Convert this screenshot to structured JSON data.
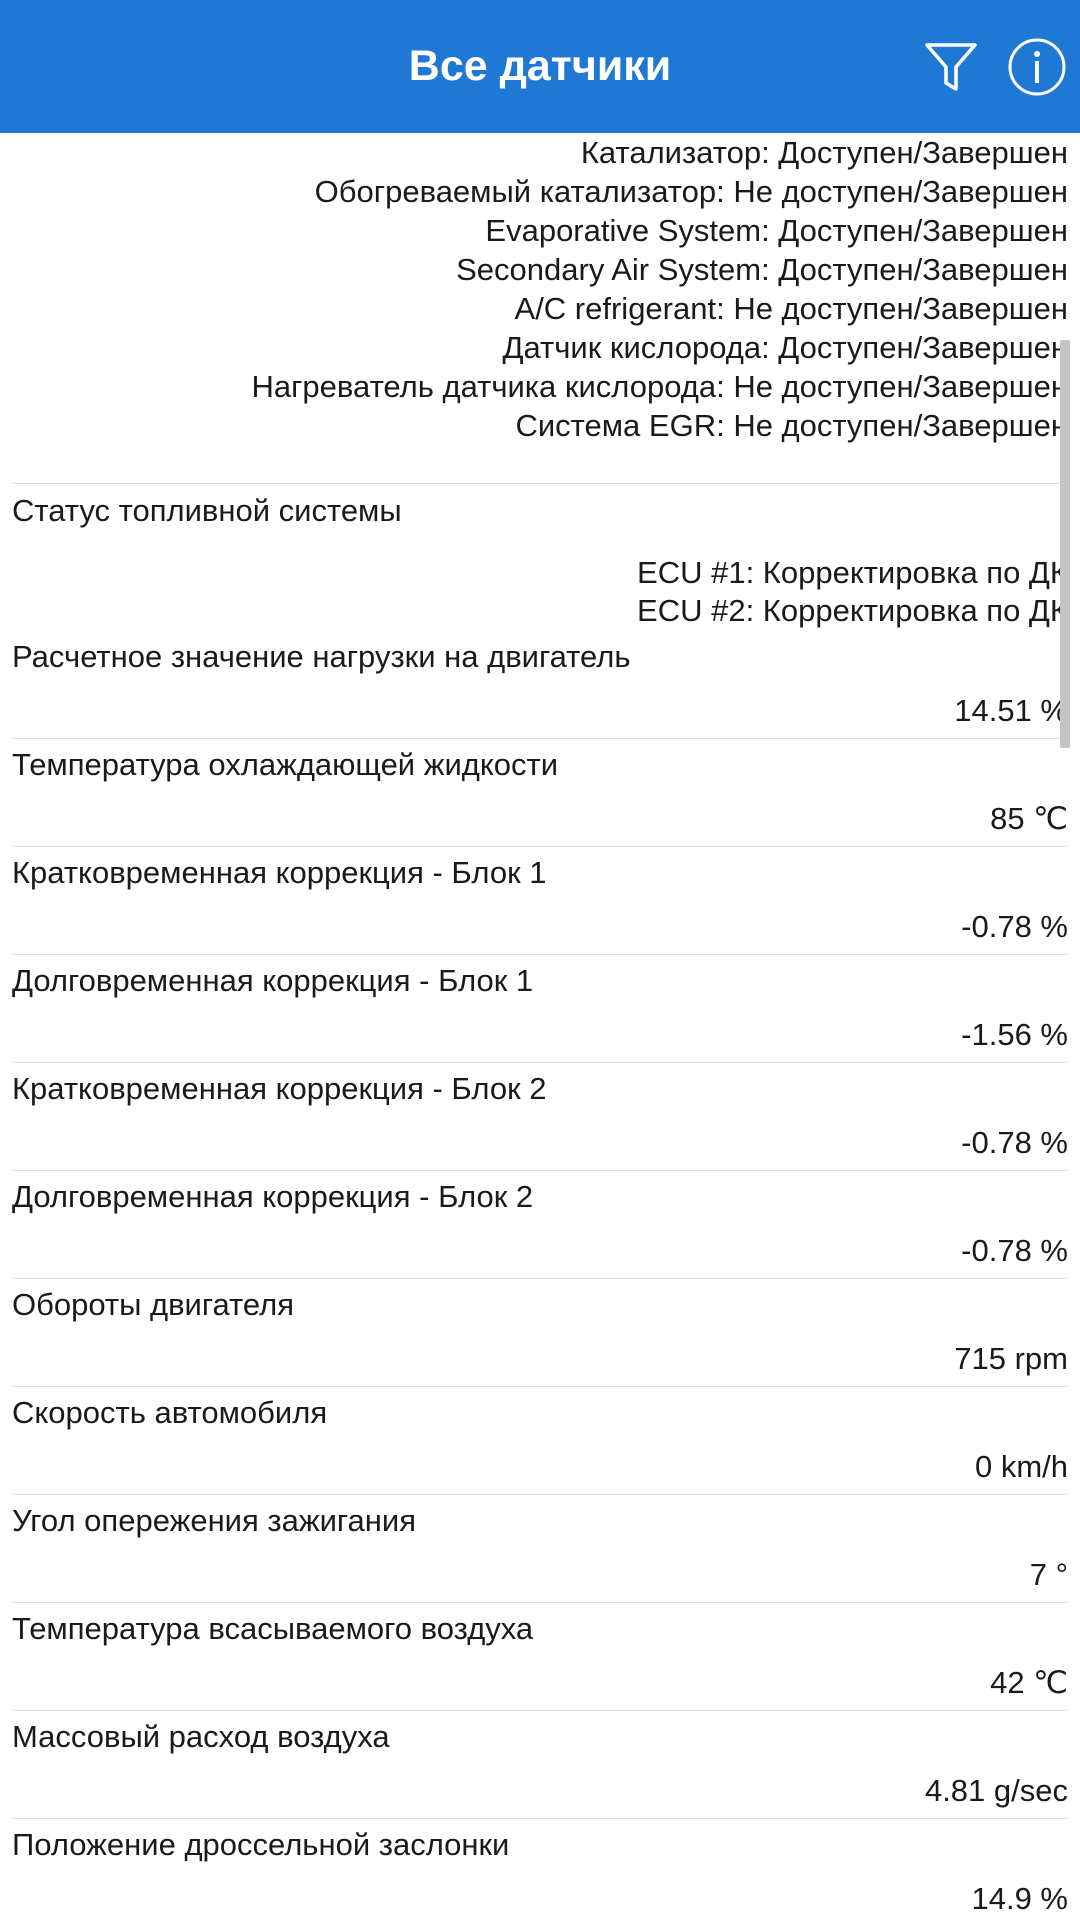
{
  "appbar": {
    "title": "Все датчики",
    "background": "#1e78d4",
    "actions": [
      {
        "icon": "filter-icon"
      },
      {
        "icon": "info-icon"
      }
    ]
  },
  "readiness_monitors": [
    "Катализатор: Доступен/Завершен",
    "Обогреваемый катализатор: Не доступен/Завершен",
    "Evaporative System: Доступен/Завершен",
    "Secondary Air System: Доступен/Завершен",
    "A/C refrigerant: Не доступен/Завершен",
    "Датчик кислорода: Доступен/Завершен",
    "Нагреватель датчика кислорода: Не доступен/Завершен",
    "Система EGR: Не доступен/Завершен"
  ],
  "fuel_system": {
    "label": "Статус топливной системы",
    "values": [
      "ECU #1: Корректировка по ДК",
      "ECU #2: Корректировка по ДК"
    ]
  },
  "sensors": [
    {
      "label": "Расчетное значение нагрузки на двигатель",
      "value": "14.51 %"
    },
    {
      "label": "Температура охлаждающей жидкости",
      "value": "85 ℃"
    },
    {
      "label": "Кратковременная коррекция - Блок 1",
      "value": "-0.78 %"
    },
    {
      "label": "Долговременная коррекция - Блок 1",
      "value": "-1.56 %"
    },
    {
      "label": "Кратковременная коррекция - Блок 2",
      "value": "-0.78 %"
    },
    {
      "label": "Долговременная коррекция - Блок 2",
      "value": "-0.78 %"
    },
    {
      "label": "Обороты двигателя",
      "value": "715 rpm"
    },
    {
      "label": "Скорость автомобиля",
      "value": "0 km/h"
    },
    {
      "label": "Угол опережения зажигания",
      "value": "7 °"
    },
    {
      "label": "Температура всасываемого воздуха",
      "value": "42 ℃"
    },
    {
      "label": "Массовый расход воздуха",
      "value": "4.81 g/sec"
    },
    {
      "label": "Положение дроссельной заслонки",
      "value": "14.9 %"
    }
  ]
}
